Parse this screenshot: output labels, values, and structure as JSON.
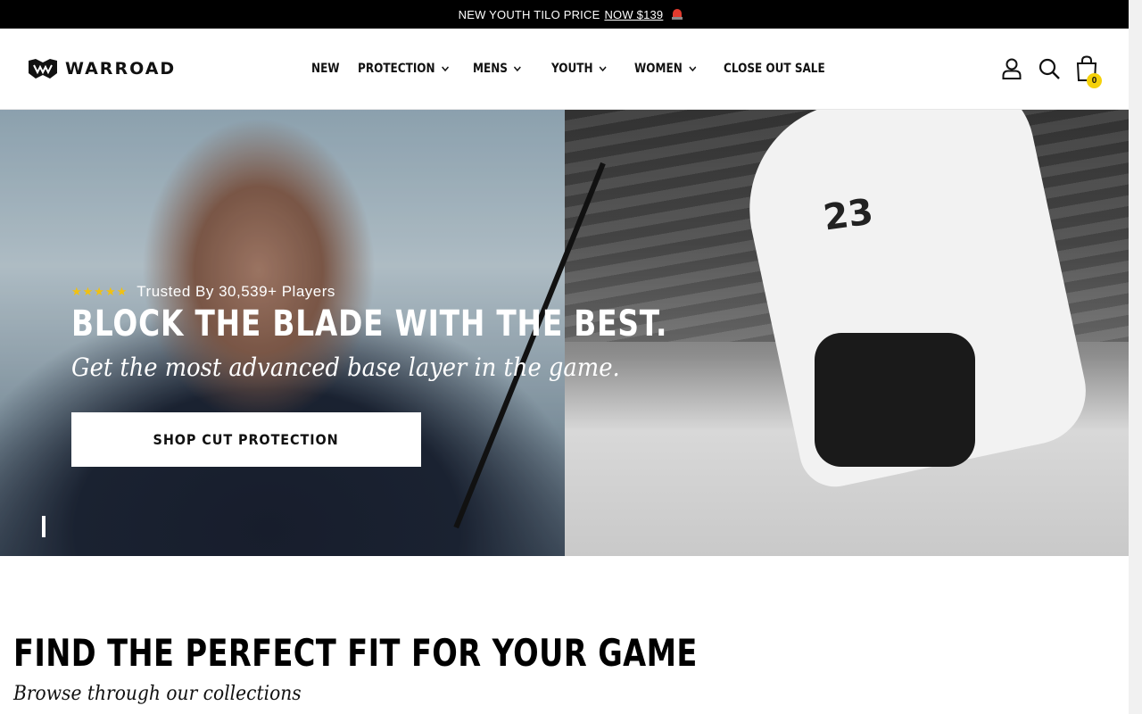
{
  "announcement": {
    "text": "NEW YOUTH TILO PRICE",
    "link": "NOW $139",
    "icon": "siren-icon"
  },
  "header": {
    "logo_text": "WARROAD",
    "nav": [
      {
        "label": "NEW",
        "dropdown": false
      },
      {
        "label": "PROTECTION",
        "dropdown": true
      },
      {
        "label": "MENS",
        "dropdown": true
      },
      {
        "label": "YOUTH",
        "dropdown": true
      },
      {
        "label": "WOMEN",
        "dropdown": true
      },
      {
        "label": "CLOSE OUT SALE",
        "dropdown": false
      }
    ],
    "icons": [
      "account-icon",
      "search-icon",
      "cart-icon"
    ],
    "cart_count": "0"
  },
  "hero": {
    "stars": "★★★★★",
    "rating_text": "Trusted By 30,539+ Players",
    "title": "BLOCK THE BLADE WITH THE BEST.",
    "subtitle": "Get the most advanced base layer in the game.",
    "cta": "SHOP CUT PROTECTION",
    "player_number": "23"
  },
  "collections": {
    "title": "FIND THE PERFECT FIT FOR YOUR GAME",
    "subtitle": "Browse through our collections"
  },
  "colors": {
    "announcement_bg": "#000000",
    "star": "#f2c10f",
    "cart_badge": "#f5d10a"
  }
}
